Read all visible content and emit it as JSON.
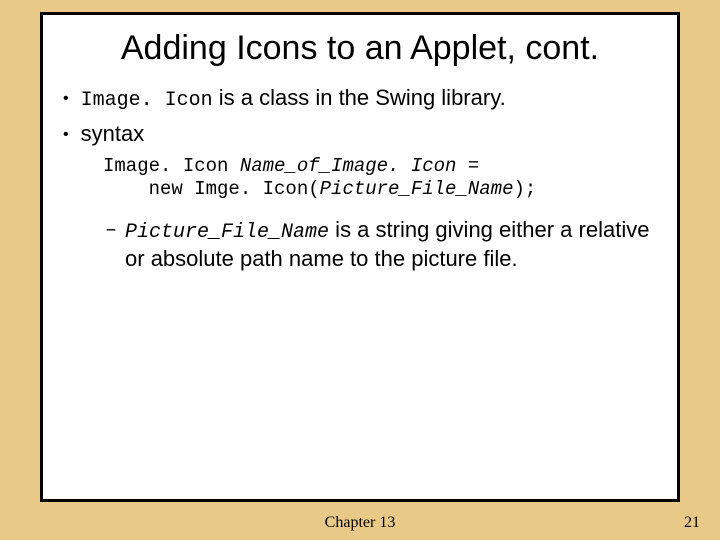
{
  "title": "Adding Icons to an Applet, cont.",
  "bullets": {
    "b1_code": "Image. Icon",
    "b1_text": " is a class in the Swing library.",
    "b2_text": "syntax"
  },
  "code": {
    "line1a": "Image. Icon ",
    "line1b": "Name_of_Image. Icon",
    "line1c": " =",
    "line2a": "    new Imge. Icon(",
    "line2b": "Picture_File_Name",
    "line2c": ");"
  },
  "sub": {
    "code": "Picture_File_Name",
    "text": " is a string giving either a relative or absolute path name to the picture file."
  },
  "footer": {
    "chapter": "Chapter 13",
    "page": "21"
  }
}
